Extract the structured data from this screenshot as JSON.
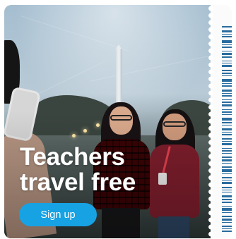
{
  "promo": {
    "headline_lines": [
      "Teachers",
      "travel free"
    ],
    "cta_label": "Sign up"
  },
  "colors": {
    "cta_background": "#17a2e4",
    "cta_text": "#ffffff",
    "headline_text": "#ffffff",
    "barcode": "#2a6c9e",
    "stub_background": "#fbfbfb"
  }
}
